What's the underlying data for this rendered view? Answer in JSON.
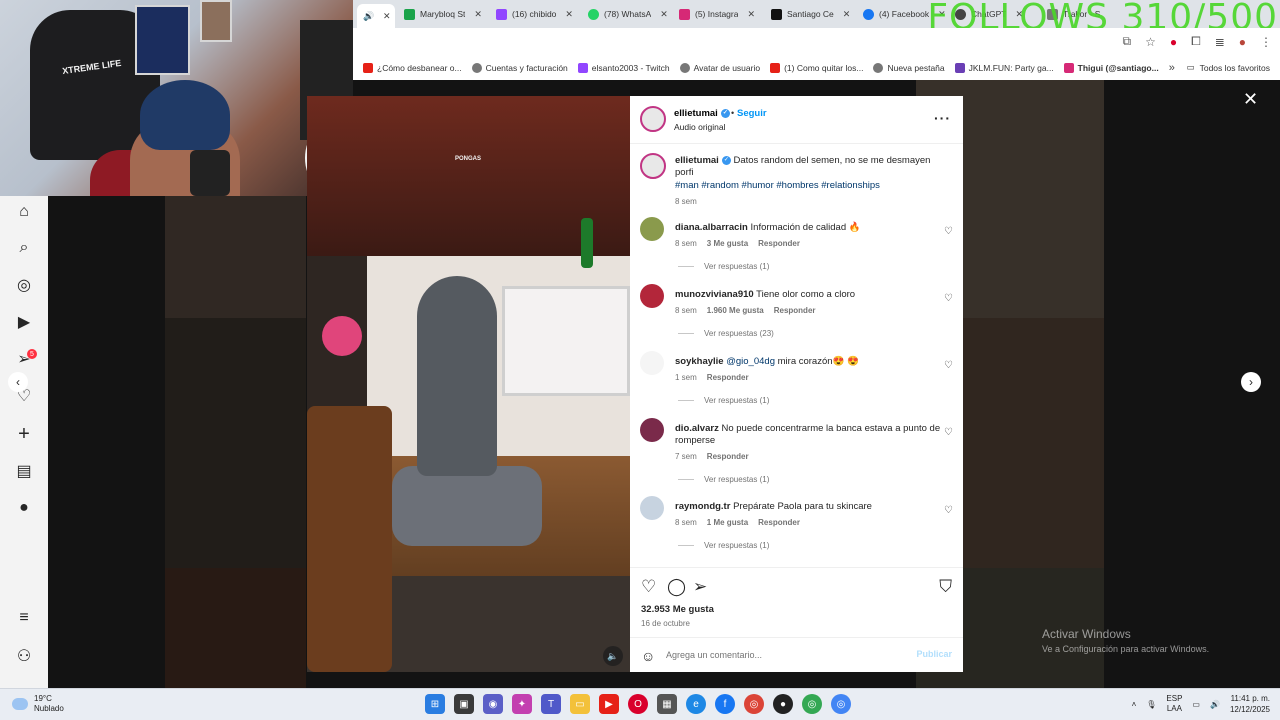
{
  "stream_overlay": {
    "follows_counter": "FOLLOWS 310/500"
  },
  "browser": {
    "tabs": [
      {
        "label": "",
        "color": "#555555"
      },
      {
        "label": "Marybloq St",
        "color": "#1aa34a"
      },
      {
        "label": "(16) chibido",
        "color": "#9146ff"
      },
      {
        "label": "(78) WhatsA",
        "color": "#25d366"
      },
      {
        "label": "(5) Instagra",
        "color": "#d62976"
      },
      {
        "label": "Santiago Ce",
        "color": "#111111"
      },
      {
        "label": "(4) Facebook",
        "color": "#1877f2"
      },
      {
        "label": "ChatGPT",
        "color": "#444444"
      },
      {
        "label": "Trakor - S",
        "color": "#777777"
      }
    ],
    "bookmarks": [
      {
        "label": "¿Cómo desbanear o...",
        "color": "#e62117"
      },
      {
        "label": "Cuentas y facturación",
        "color": "#555555"
      },
      {
        "label": "elsanto2003 - Twitch",
        "color": "#9146ff"
      },
      {
        "label": "Avatar de usuario",
        "color": "#555555"
      },
      {
        "label": "(1) Como quitar los...",
        "color": "#e62117"
      },
      {
        "label": "Nueva pestaña",
        "color": "#555555"
      },
      {
        "label": "JKLM.FUN: Party ga...",
        "color": "#6a3fb5"
      },
      {
        "label": "Thigui (@santiago...",
        "color": "#d62976"
      }
    ],
    "all_bookmarks_label": "Todos los favoritos"
  },
  "post": {
    "author": "ellietumai",
    "follow_label": "Seguir",
    "audio_label": "Audio original",
    "media_watermark": "PONGAS",
    "caption": {
      "username": "ellietumai",
      "text": "Datos random del semen, no se me desmayen porfi",
      "hashtags": "#man #random #humor #hombres #relationships",
      "age": "8 sem"
    },
    "comments": [
      {
        "username": "diana.albarracin",
        "text": "Información de calidad 🔥",
        "age": "8 sem",
        "likes": "3 Me gusta",
        "reply": "Responder",
        "replies": "Ver respuestas (1)",
        "avatar_color": "#8a9a4c"
      },
      {
        "username": "munozviviana910",
        "text": "Tiene olor como a cloro",
        "age": "8 sem",
        "likes": "1.960 Me gusta",
        "reply": "Responder",
        "replies": "Ver respuestas (23)",
        "avatar_color": "#b3263a"
      },
      {
        "username": "soykhaylie",
        "mention": "@gio_04dg",
        "text": "mira corazón😍 😍",
        "age": "1 sem",
        "likes": "",
        "reply": "Responder",
        "replies": "Ver respuestas (1)",
        "avatar_color": "#f5f5f5"
      },
      {
        "username": "dio.alvarz",
        "text": "No puede concentrarme la banca estava a punto de romperse",
        "age": "7 sem",
        "likes": "",
        "reply": "Responder",
        "replies": "Ver respuestas (1)",
        "avatar_color": "#7a2a4a"
      },
      {
        "username": "raymondg.tr",
        "text": "Prepárate Paola para tu skincare",
        "age": "8 sem",
        "likes": "1 Me gusta",
        "reply": "Responder",
        "replies": "Ver respuestas (1)",
        "avatar_color": "#c7d3e0"
      }
    ],
    "like_count": "32.953 Me gusta",
    "date": "16 de octubre",
    "comment_placeholder": "Agrega un comentario...",
    "publish_label": "Publicar"
  },
  "windows_watermark": {
    "title": "Activar Windows",
    "subtitle": "Ve a Configuración para activar Windows."
  },
  "taskbar": {
    "temperature": "19°C",
    "weather": "Nublado",
    "lang_top": "ESP",
    "lang_bottom": "LAA",
    "time": "11:41 p. m.",
    "date": "12/12/2025"
  }
}
